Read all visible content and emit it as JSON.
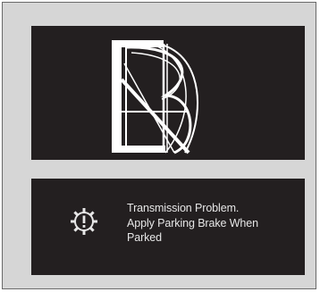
{
  "colors": {
    "panel_background": "#d6d6d6",
    "screen_background": "#231f20",
    "foreground": "#e6e6e6"
  },
  "logo_screen": {
    "icon": "brand-logo-icon"
  },
  "message_screen": {
    "icon": "gear-warning-icon",
    "lines": [
      "Transmission Problem.",
      "Apply Parking Brake When",
      "Parked"
    ]
  }
}
